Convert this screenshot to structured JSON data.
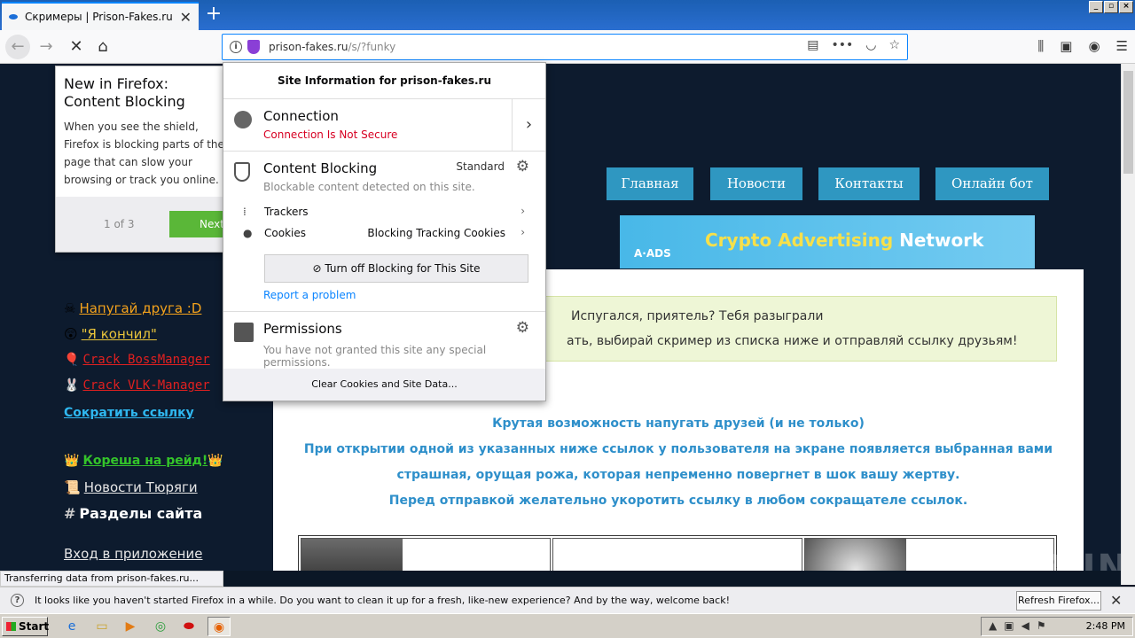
{
  "browser": {
    "tab_title": "Скримеры | Prison-Fakes.ru",
    "url_host": "prison-fakes.ru",
    "url_path": "/s/?funky"
  },
  "site": {
    "menu": [
      "Главная",
      "Новости",
      "Контакты",
      "Онлайн бот"
    ],
    "ad": {
      "logo": "A·ADS",
      "text_yellow": "Crypto Advertising",
      "text_white": "Network"
    },
    "notice_line1": "Испугался, приятель? Тебя разыграли",
    "notice_line2": "ать, выбирай скример из списка ниже и отправляй ссылку друзьям!",
    "blue_lines": [
      "Крутая возможность напугать друзей (и не только)",
      "При открытии одной из указанных ниже ссылок у пользователя на экране появляется выбранная вами",
      "страшная, орущая рожа, которая непременно повергнет в шок вашу жертву.",
      "Перед отправкой желательно укоротить ссылку в любом сокращателе ссылок."
    ],
    "sidebar": [
      {
        "icon": "☠",
        "label": "Напугай друга :D",
        "color": "#f3a21c"
      },
      {
        "icon": "😲",
        "label": "\"Я кончил\"",
        "color": "#e9c43b"
      },
      {
        "icon": "🎈",
        "label": "Crack BossManager",
        "color": "#e02020"
      },
      {
        "icon": "🐰",
        "label": "Crack VLK-Manager",
        "color": "#e02020"
      },
      {
        "icon": "",
        "label": "Сократить ссылку",
        "color": "#2fb8f0"
      },
      {
        "icon": "👑",
        "label": "Кореша на рейд!",
        "color": "#34c42a",
        "trail": "👑"
      },
      {
        "icon": "📜",
        "label": "Новости Тюряги",
        "color": "#e6e6e6"
      },
      {
        "icon": "#",
        "label": "Разделы сайта",
        "color": "#ffffff"
      },
      {
        "icon": "",
        "label": "Вход в приложение",
        "color": "#e6e6e6"
      }
    ],
    "watermark": "ANY▷RUN"
  },
  "onboarding": {
    "title": "New in Firefox: Content Blocking",
    "body": "When you see the shield, Firefox is blocking parts of the page that can slow your browsing or track you online.",
    "counter": "1 of 3",
    "next": "Next"
  },
  "panel": {
    "header": "Site Information for prison-fakes.ru",
    "connection_title": "Connection",
    "connection_status": "Connection Is Not Secure",
    "cb_title": "Content Blocking",
    "cb_mode": "Standard",
    "cb_desc": "Blockable content detected on this site.",
    "trackers": "Trackers",
    "cookies": "Cookies",
    "cookies_value": "Blocking Tracking Cookies",
    "turn_off": "Turn off Blocking for This Site",
    "report": "Report a problem",
    "perm_title": "Permissions",
    "perm_desc": "You have not granted this site any special permissions.",
    "clear": "Clear Cookies and Site Data..."
  },
  "status_text": "Transferring data from prison-fakes.ru...",
  "notification": {
    "message": "It looks like you haven't started Firefox in a while. Do you want to clean it up for a fresh, like-new experience? And by the way, welcome back!",
    "button": "Refresh Firefox..."
  },
  "taskbar": {
    "start": "Start",
    "clock": "2:48 PM"
  }
}
